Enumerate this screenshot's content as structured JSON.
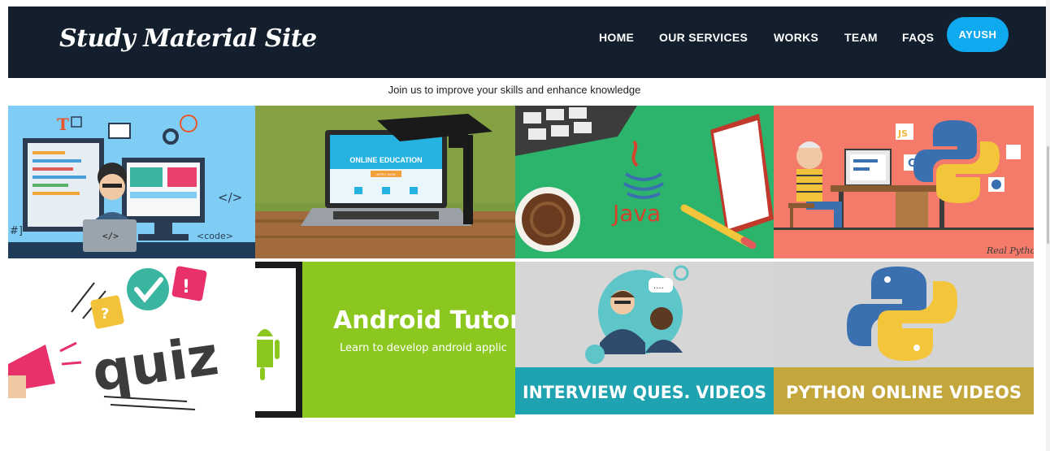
{
  "header": {
    "brand": "Study Material Site",
    "nav": [
      "HOME",
      "OUR SERVICES",
      "WORKS",
      "TEAM",
      "FAQS"
    ],
    "user_button": "AYUSH"
  },
  "tagline": "Join us to improve your skills and enhance knowledge",
  "tiles": {
    "coding": {
      "t": "T",
      "tag_open": "</>",
      "laptop_tag": "</>",
      "code_tag": "<code>",
      "bracket": "#]"
    },
    "online_education": {
      "title": "ONLINE EDUCATION",
      "button": "APPLY NOW"
    },
    "java": {
      "label": "Java"
    },
    "python_dev": {
      "js": "JS",
      "c": "C",
      "signature": "Real Pytho"
    },
    "quiz": {
      "label": "quiz",
      "question": "?",
      "exclaim": "!"
    },
    "android": {
      "title": "Android Tutor",
      "subtitle": "Learn to develop android applic"
    },
    "interview": {
      "caption": "INTERVIEW QUES. VIDEOS",
      "bubble": "...."
    },
    "python_videos": {
      "caption": "PYTHON ONLINE VIDEOS"
    }
  },
  "colors": {
    "navbar": "#131f2c",
    "accent": "#0fa9ef",
    "coding_bg": "#7fcdf5",
    "java_bg": "#2cb46c",
    "python_bg": "#f47a6a",
    "android_bg": "#8bc71f",
    "interview_caption_bg": "#20a3b1",
    "python_caption_bg": "#c3a63c"
  }
}
